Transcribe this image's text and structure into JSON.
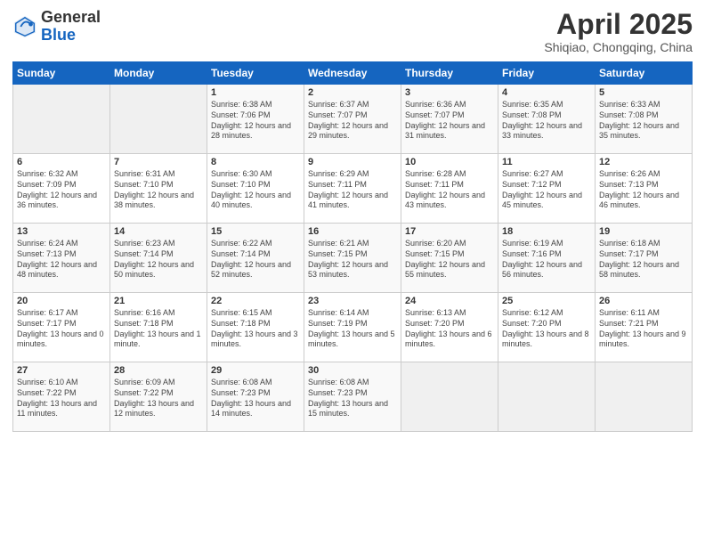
{
  "header": {
    "logo_general": "General",
    "logo_blue": "Blue",
    "month": "April 2025",
    "location": "Shiqiao, Chongqing, China"
  },
  "days_of_week": [
    "Sunday",
    "Monday",
    "Tuesday",
    "Wednesday",
    "Thursday",
    "Friday",
    "Saturday"
  ],
  "weeks": [
    [
      {
        "day": "",
        "info": ""
      },
      {
        "day": "",
        "info": ""
      },
      {
        "day": "1",
        "info": "Sunrise: 6:38 AM\nSunset: 7:06 PM\nDaylight: 12 hours and 28 minutes."
      },
      {
        "day": "2",
        "info": "Sunrise: 6:37 AM\nSunset: 7:07 PM\nDaylight: 12 hours and 29 minutes."
      },
      {
        "day": "3",
        "info": "Sunrise: 6:36 AM\nSunset: 7:07 PM\nDaylight: 12 hours and 31 minutes."
      },
      {
        "day": "4",
        "info": "Sunrise: 6:35 AM\nSunset: 7:08 PM\nDaylight: 12 hours and 33 minutes."
      },
      {
        "day": "5",
        "info": "Sunrise: 6:33 AM\nSunset: 7:08 PM\nDaylight: 12 hours and 35 minutes."
      }
    ],
    [
      {
        "day": "6",
        "info": "Sunrise: 6:32 AM\nSunset: 7:09 PM\nDaylight: 12 hours and 36 minutes."
      },
      {
        "day": "7",
        "info": "Sunrise: 6:31 AM\nSunset: 7:10 PM\nDaylight: 12 hours and 38 minutes."
      },
      {
        "day": "8",
        "info": "Sunrise: 6:30 AM\nSunset: 7:10 PM\nDaylight: 12 hours and 40 minutes."
      },
      {
        "day": "9",
        "info": "Sunrise: 6:29 AM\nSunset: 7:11 PM\nDaylight: 12 hours and 41 minutes."
      },
      {
        "day": "10",
        "info": "Sunrise: 6:28 AM\nSunset: 7:11 PM\nDaylight: 12 hours and 43 minutes."
      },
      {
        "day": "11",
        "info": "Sunrise: 6:27 AM\nSunset: 7:12 PM\nDaylight: 12 hours and 45 minutes."
      },
      {
        "day": "12",
        "info": "Sunrise: 6:26 AM\nSunset: 7:13 PM\nDaylight: 12 hours and 46 minutes."
      }
    ],
    [
      {
        "day": "13",
        "info": "Sunrise: 6:24 AM\nSunset: 7:13 PM\nDaylight: 12 hours and 48 minutes."
      },
      {
        "day": "14",
        "info": "Sunrise: 6:23 AM\nSunset: 7:14 PM\nDaylight: 12 hours and 50 minutes."
      },
      {
        "day": "15",
        "info": "Sunrise: 6:22 AM\nSunset: 7:14 PM\nDaylight: 12 hours and 52 minutes."
      },
      {
        "day": "16",
        "info": "Sunrise: 6:21 AM\nSunset: 7:15 PM\nDaylight: 12 hours and 53 minutes."
      },
      {
        "day": "17",
        "info": "Sunrise: 6:20 AM\nSunset: 7:15 PM\nDaylight: 12 hours and 55 minutes."
      },
      {
        "day": "18",
        "info": "Sunrise: 6:19 AM\nSunset: 7:16 PM\nDaylight: 12 hours and 56 minutes."
      },
      {
        "day": "19",
        "info": "Sunrise: 6:18 AM\nSunset: 7:17 PM\nDaylight: 12 hours and 58 minutes."
      }
    ],
    [
      {
        "day": "20",
        "info": "Sunrise: 6:17 AM\nSunset: 7:17 PM\nDaylight: 13 hours and 0 minutes."
      },
      {
        "day": "21",
        "info": "Sunrise: 6:16 AM\nSunset: 7:18 PM\nDaylight: 13 hours and 1 minute."
      },
      {
        "day": "22",
        "info": "Sunrise: 6:15 AM\nSunset: 7:18 PM\nDaylight: 13 hours and 3 minutes."
      },
      {
        "day": "23",
        "info": "Sunrise: 6:14 AM\nSunset: 7:19 PM\nDaylight: 13 hours and 5 minutes."
      },
      {
        "day": "24",
        "info": "Sunrise: 6:13 AM\nSunset: 7:20 PM\nDaylight: 13 hours and 6 minutes."
      },
      {
        "day": "25",
        "info": "Sunrise: 6:12 AM\nSunset: 7:20 PM\nDaylight: 13 hours and 8 minutes."
      },
      {
        "day": "26",
        "info": "Sunrise: 6:11 AM\nSunset: 7:21 PM\nDaylight: 13 hours and 9 minutes."
      }
    ],
    [
      {
        "day": "27",
        "info": "Sunrise: 6:10 AM\nSunset: 7:22 PM\nDaylight: 13 hours and 11 minutes."
      },
      {
        "day": "28",
        "info": "Sunrise: 6:09 AM\nSunset: 7:22 PM\nDaylight: 13 hours and 12 minutes."
      },
      {
        "day": "29",
        "info": "Sunrise: 6:08 AM\nSunset: 7:23 PM\nDaylight: 13 hours and 14 minutes."
      },
      {
        "day": "30",
        "info": "Sunrise: 6:08 AM\nSunset: 7:23 PM\nDaylight: 13 hours and 15 minutes."
      },
      {
        "day": "",
        "info": ""
      },
      {
        "day": "",
        "info": ""
      },
      {
        "day": "",
        "info": ""
      }
    ]
  ]
}
